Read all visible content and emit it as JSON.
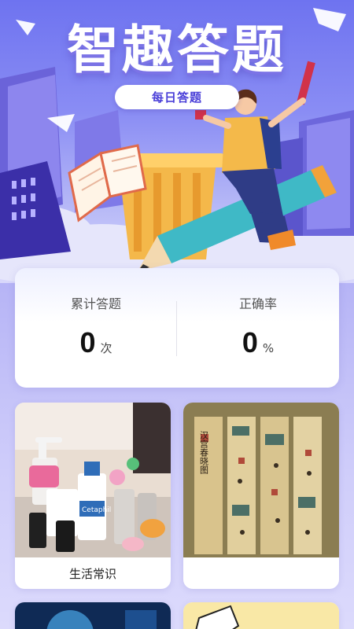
{
  "header": {
    "title": "智趣答题",
    "daily_button": "每日答题"
  },
  "stats": {
    "total": {
      "label": "累计答题",
      "value": "0",
      "unit": "次"
    },
    "accuracy": {
      "label": "正确率",
      "value": "0",
      "unit": "%"
    }
  },
  "categories": [
    {
      "label": "生活常识",
      "image": "skincare-bottles-photo"
    },
    {
      "label": "",
      "image": "han-palace-scroll-painting",
      "scroll_title": "汉宫春晓图"
    },
    {
      "label": "",
      "image": "tech-blue-photo"
    },
    {
      "label": "",
      "image": "comic-yellow-illustration"
    }
  ],
  "colors": {
    "accent": "#4a3fd8",
    "background": "#b6b4f6"
  }
}
